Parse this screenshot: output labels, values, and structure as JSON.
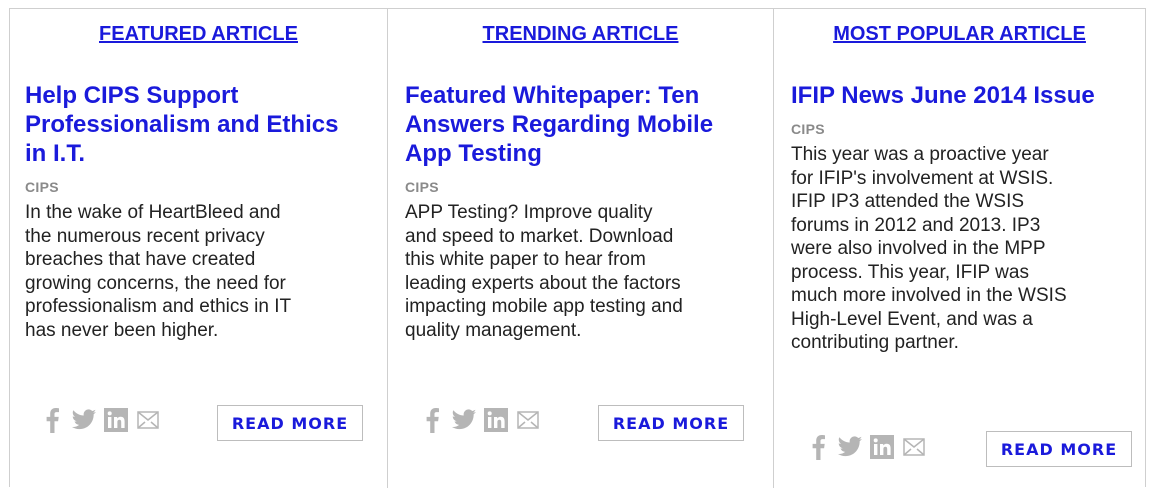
{
  "columns": [
    {
      "header": "FEATURED ARTICLE",
      "title": "Help CIPS Support Professionalism and Ethics in I.T.",
      "title_lines": [
        "Help CIPS Support",
        "Professionalism and Ethics",
        "in I.T."
      ],
      "source": "CIPS",
      "description_lines": [
        "In the wake of HeartBleed and",
        "the numerous recent privacy",
        "breaches that have created",
        "growing concerns, the need for",
        "professionalism and ethics in IT",
        "has never been higher."
      ],
      "share_icons": [
        "facebook-icon",
        "twitter-icon",
        "linkedin-icon",
        "email-icon"
      ],
      "read_more": "READ MORE"
    },
    {
      "header": "TRENDING ARTICLE",
      "title_lines": [
        "Featured Whitepaper: Ten",
        "Answers Regarding Mobile",
        "App Testing"
      ],
      "source": "CIPS",
      "description_lines": [
        "APP Testing? Improve quality",
        "and speed to market. Download",
        "this white paper to hear from",
        "leading experts about the factors",
        "impacting mobile app testing and",
        "quality management."
      ],
      "share_icons": [
        "facebook-icon",
        "twitter-icon",
        "linkedin-icon",
        "email-icon"
      ],
      "read_more": "READ MORE"
    },
    {
      "header": "MOST POPULAR ARTICLE",
      "title_lines": [
        "IFIP News June 2014 Issue"
      ],
      "source": "CIPS",
      "description_lines": [
        "This year was a proactive year",
        "for IFIP's involvement at WSIS.",
        "IFIP IP3 attended the WSIS",
        "forums in 2012 and 2013. IP3",
        "were also involved in the MPP",
        "process. This year, IFIP was",
        "much more involved in the WSIS",
        "High-Level Event, and was a",
        "contributing partner."
      ],
      "share_icons": [
        "facebook-icon",
        "twitter-icon",
        "linkedin-icon",
        "email-icon"
      ],
      "read_more": "READ MORE"
    }
  ],
  "colors": {
    "link": "#1a1adb",
    "source": "#8a8a8a",
    "text": "#222222",
    "icon": "#b5b5b5",
    "border": "#cfcfcf"
  }
}
